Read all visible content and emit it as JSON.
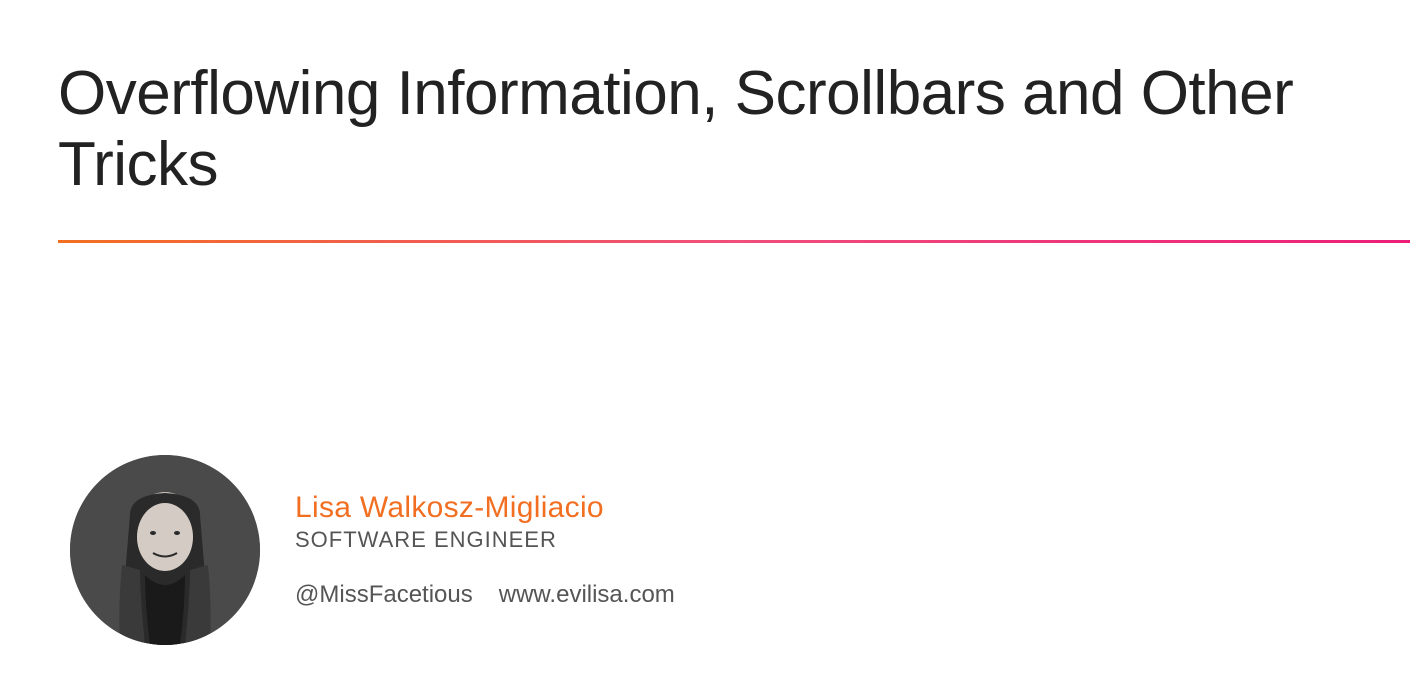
{
  "slide": {
    "title": "Overflowing Information, Scrollbars and Other Tricks"
  },
  "author": {
    "name": "Lisa Walkosz-Migliacio",
    "role": "SOFTWARE ENGINEER",
    "handle": "@MissFacetious",
    "website": "www.evilisa.com"
  }
}
